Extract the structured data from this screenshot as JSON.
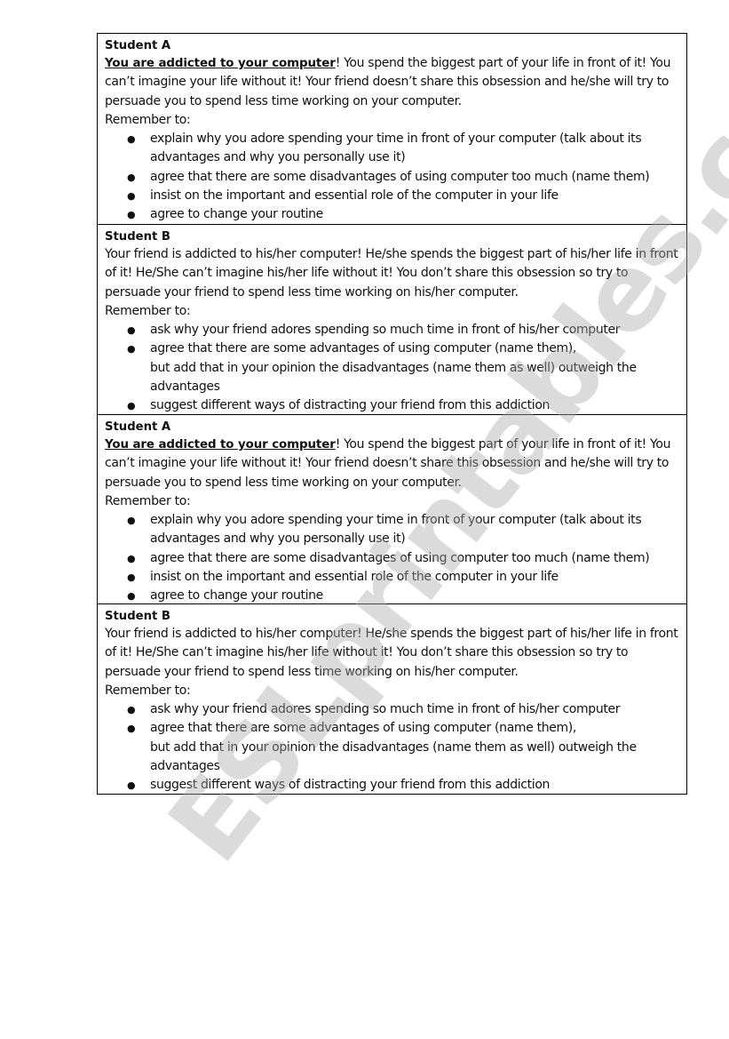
{
  "watermark": "ESLprintables.com",
  "cards": [
    {
      "title": "Student A",
      "lead": "You are addicted to your computer",
      "intro": "! You spend the biggest part of your life in front of it! You can’t imagine your life without it! Your friend doesn’t share this obsession and he/she will try to persuade you to spend less time working on your computer.",
      "remember": "Remember to:",
      "bullets": [
        "explain why you adore spending your time in front of your computer (talk about its advantages and why you personally use it)",
        "agree that there are some disadvantages of using computer too much (name them)",
        "insist on the important and essential role of the computer in your life",
        "agree to change your routine"
      ]
    },
    {
      "title": "Student B",
      "lead": "",
      "intro": "Your friend is addicted to his/her computer! He/she spends the biggest part of his/her life in front of it! He/She can’t imagine his/her life without it! You don’t share this obsession so try to persuade your friend to spend less time working on his/her computer.",
      "remember": "Remember to:",
      "bullets": [
        "ask why your friend adores spending so much time in front of his/her computer",
        "agree that there are some advantages of using computer (name them),\nbut add that in your opinion the disadvantages (name them as well) outweigh the advantages",
        "suggest different ways of distracting your friend from this addiction"
      ]
    },
    {
      "title": "Student A",
      "lead": "You are addicted to your computer",
      "intro": "! You spend the biggest part of your life in front of it! You can’t imagine your life without it! Your friend doesn’t share this obsession and he/she will try to persuade you to spend less time working on your computer.",
      "remember": "Remember to:",
      "bullets": [
        "explain why you adore spending your time in front of your computer (talk about its advantages and why you personally use it)",
        "agree that there are some disadvantages of using computer too much (name them)",
        "insist on the important and essential role of the computer in your life",
        "agree to change your routine"
      ]
    },
    {
      "title": "Student B",
      "lead": "",
      "intro": "Your friend is addicted to his/her computer! He/she spends the biggest part of his/her life in front of it! He/She can’t imagine his/her life without it! You don’t share this obsession so try to persuade your friend to spend less time working on his/her computer.",
      "remember": "Remember to:",
      "bullets": [
        "ask why your friend adores spending so much time in front of his/her computer",
        "agree that there are some advantages of using computer (name them),\nbut add that in your opinion the disadvantages (name them as well) outweigh the advantages",
        "suggest different ways of distracting your friend from this addiction"
      ]
    }
  ]
}
